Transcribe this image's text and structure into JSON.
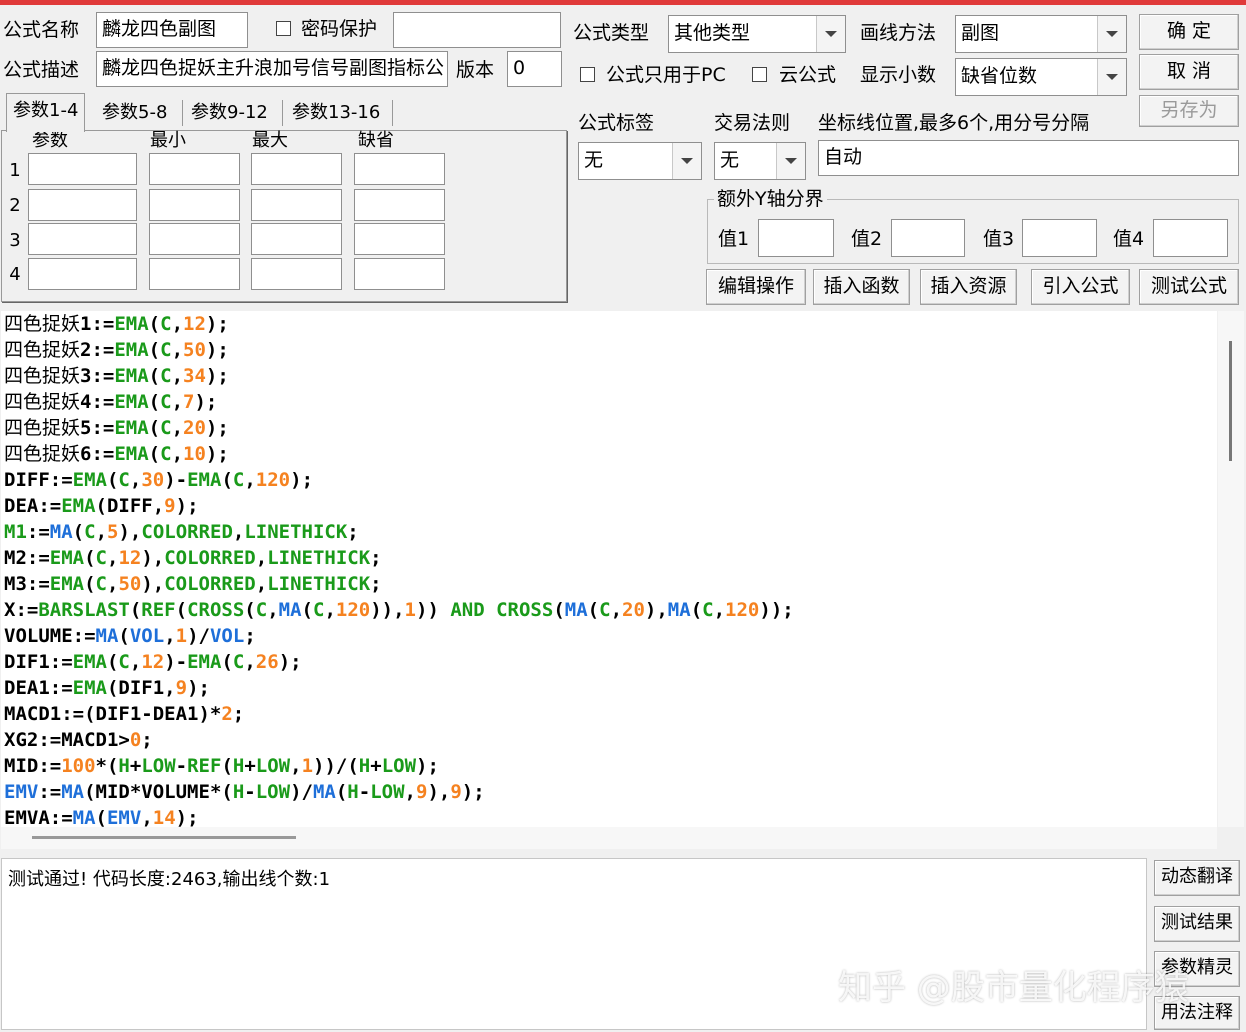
{
  "header": {
    "name_label": "公式名称",
    "name_value": "麟龙四色副图",
    "password_label": "密码保护",
    "password_value": "",
    "desc_label": "公式描述",
    "desc_value": "麟龙四色捉妖主升浪加号信号副图指标公",
    "version_label": "版本",
    "version_value": "0"
  },
  "settings": {
    "type_label": "公式类型",
    "type_value": "其他类型",
    "draw_label": "画线方法",
    "draw_value": "副图",
    "pc_only_label": "公式只用于PC",
    "cloud_label": "云公式",
    "decimal_label": "显示小数",
    "decimal_value": "缺省位数",
    "tag_label": "公式标签",
    "tag_value": "无",
    "rule_label": "交易法则",
    "rule_value": "无",
    "axis_label": "坐标线位置,最多6个,用分号分隔",
    "axis_value": "自动",
    "extra_y_label": "额外Y轴分界",
    "val1": "值1",
    "val2": "值2",
    "val3": "值3",
    "val4": "值4"
  },
  "buttons": {
    "ok": "确  定",
    "cancel": "取  消",
    "save_as": "另存为",
    "edit": "编辑操作",
    "insert_func": "插入函数",
    "insert_res": "插入资源",
    "import": "引入公式",
    "test": "测试公式",
    "dynamic": "动态翻译",
    "result": "测试结果",
    "wizard": "参数精灵",
    "usage": "用法注释"
  },
  "tabs": [
    "参数1-4",
    "参数5-8",
    "参数9-12",
    "参数13-16"
  ],
  "params": {
    "headers": [
      "参数",
      "最小",
      "最大",
      "缺省"
    ],
    "rows": [
      "1",
      "2",
      "3",
      "4"
    ]
  },
  "code_lines": [
    [
      [
        "cn",
        "四色捉妖"
      ],
      [
        "b",
        "1:="
      ],
      [
        "g",
        "EMA"
      ],
      [
        "b",
        "("
      ],
      [
        "g",
        "C"
      ],
      [
        "b",
        ","
      ],
      [
        "o",
        "12"
      ],
      [
        "b",
        ");"
      ]
    ],
    [
      [
        "cn",
        "四色捉妖"
      ],
      [
        "b",
        "2:="
      ],
      [
        "g",
        "EMA"
      ],
      [
        "b",
        "("
      ],
      [
        "g",
        "C"
      ],
      [
        "b",
        ","
      ],
      [
        "o",
        "50"
      ],
      [
        "b",
        ");"
      ]
    ],
    [
      [
        "cn",
        "四色捉妖"
      ],
      [
        "b",
        "3:="
      ],
      [
        "g",
        "EMA"
      ],
      [
        "b",
        "("
      ],
      [
        "g",
        "C"
      ],
      [
        "b",
        ","
      ],
      [
        "o",
        "34"
      ],
      [
        "b",
        ");"
      ]
    ],
    [
      [
        "cn",
        "四色捉妖"
      ],
      [
        "b",
        "4:="
      ],
      [
        "g",
        "EMA"
      ],
      [
        "b",
        "("
      ],
      [
        "g",
        "C"
      ],
      [
        "b",
        ","
      ],
      [
        "o",
        "7"
      ],
      [
        "b",
        ");"
      ]
    ],
    [
      [
        "cn",
        "四色捉妖"
      ],
      [
        "b",
        "5:="
      ],
      [
        "g",
        "EMA"
      ],
      [
        "b",
        "("
      ],
      [
        "g",
        "C"
      ],
      [
        "b",
        ","
      ],
      [
        "o",
        "20"
      ],
      [
        "b",
        ");"
      ]
    ],
    [
      [
        "cn",
        "四色捉妖"
      ],
      [
        "b",
        "6:="
      ],
      [
        "g",
        "EMA"
      ],
      [
        "b",
        "("
      ],
      [
        "g",
        "C"
      ],
      [
        "b",
        ","
      ],
      [
        "o",
        "10"
      ],
      [
        "b",
        ");"
      ]
    ],
    [
      [
        "b",
        "DIFF:="
      ],
      [
        "g",
        "EMA"
      ],
      [
        "b",
        "("
      ],
      [
        "g",
        "C"
      ],
      [
        "b",
        ","
      ],
      [
        "o",
        "30"
      ],
      [
        "b",
        ")-"
      ],
      [
        "g",
        "EMA"
      ],
      [
        "b",
        "("
      ],
      [
        "g",
        "C"
      ],
      [
        "b",
        ","
      ],
      [
        "o",
        "120"
      ],
      [
        "b",
        ");"
      ]
    ],
    [
      [
        "b",
        "DEA:="
      ],
      [
        "g",
        "EMA"
      ],
      [
        "b",
        "(DIFF,"
      ],
      [
        "o",
        "9"
      ],
      [
        "b",
        ");"
      ]
    ],
    [
      [
        "g",
        "M1"
      ],
      [
        "b",
        ":="
      ],
      [
        "bl",
        "MA"
      ],
      [
        "b",
        "("
      ],
      [
        "g",
        "C"
      ],
      [
        "b",
        ","
      ],
      [
        "o",
        "5"
      ],
      [
        "b",
        "),"
      ],
      [
        "g",
        "COLORRED"
      ],
      [
        "b",
        ","
      ],
      [
        "g",
        "LINETHICK"
      ],
      [
        "b",
        ";"
      ]
    ],
    [
      [
        "b",
        "M2:="
      ],
      [
        "g",
        "EMA"
      ],
      [
        "b",
        "("
      ],
      [
        "g",
        "C"
      ],
      [
        "b",
        ","
      ],
      [
        "o",
        "12"
      ],
      [
        "b",
        "),"
      ],
      [
        "g",
        "COLORRED"
      ],
      [
        "b",
        ","
      ],
      [
        "g",
        "LINETHICK"
      ],
      [
        "b",
        ";"
      ]
    ],
    [
      [
        "b",
        "M3:="
      ],
      [
        "g",
        "EMA"
      ],
      [
        "b",
        "("
      ],
      [
        "g",
        "C"
      ],
      [
        "b",
        ","
      ],
      [
        "o",
        "50"
      ],
      [
        "b",
        "),"
      ],
      [
        "g",
        "COLORRED"
      ],
      [
        "b",
        ","
      ],
      [
        "g",
        "LINETHICK"
      ],
      [
        "b",
        ";"
      ]
    ],
    [
      [
        "b",
        "X:="
      ],
      [
        "g",
        "BARSLAST"
      ],
      [
        "b",
        "("
      ],
      [
        "g",
        "REF"
      ],
      [
        "b",
        "("
      ],
      [
        "g",
        "CROSS"
      ],
      [
        "b",
        "("
      ],
      [
        "g",
        "C"
      ],
      [
        "b",
        ","
      ],
      [
        "bl",
        "MA"
      ],
      [
        "b",
        "("
      ],
      [
        "g",
        "C"
      ],
      [
        "b",
        ","
      ],
      [
        "o",
        "120"
      ],
      [
        "b",
        ")),"
      ],
      [
        "o",
        "1"
      ],
      [
        "b",
        ")) "
      ],
      [
        "g",
        "AND"
      ],
      [
        "b",
        " "
      ],
      [
        "g",
        "CROSS"
      ],
      [
        "b",
        "("
      ],
      [
        "bl",
        "MA"
      ],
      [
        "b",
        "("
      ],
      [
        "g",
        "C"
      ],
      [
        "b",
        ","
      ],
      [
        "o",
        "20"
      ],
      [
        "b",
        "),"
      ],
      [
        "bl",
        "MA"
      ],
      [
        "b",
        "("
      ],
      [
        "g",
        "C"
      ],
      [
        "b",
        ","
      ],
      [
        "o",
        "120"
      ],
      [
        "b",
        "));"
      ]
    ],
    [
      [
        "b",
        "VOLUME:="
      ],
      [
        "bl",
        "MA"
      ],
      [
        "b",
        "("
      ],
      [
        "bl",
        "VOL"
      ],
      [
        "b",
        ","
      ],
      [
        "o",
        "1"
      ],
      [
        "b",
        ")/"
      ],
      [
        "bl",
        "VOL"
      ],
      [
        "b",
        ";"
      ]
    ],
    [
      [
        "b",
        "DIF1:="
      ],
      [
        "g",
        "EMA"
      ],
      [
        "b",
        "("
      ],
      [
        "g",
        "C"
      ],
      [
        "b",
        ","
      ],
      [
        "o",
        "12"
      ],
      [
        "b",
        ")-"
      ],
      [
        "g",
        "EMA"
      ],
      [
        "b",
        "("
      ],
      [
        "g",
        "C"
      ],
      [
        "b",
        ","
      ],
      [
        "o",
        "26"
      ],
      [
        "b",
        ");"
      ]
    ],
    [
      [
        "b",
        "DEA1:="
      ],
      [
        "g",
        "EMA"
      ],
      [
        "b",
        "(DIF1,"
      ],
      [
        "o",
        "9"
      ],
      [
        "b",
        ");"
      ]
    ],
    [
      [
        "b",
        "MACD1:=(DIF1-DEA1)*"
      ],
      [
        "o",
        "2"
      ],
      [
        "b",
        ";"
      ]
    ],
    [
      [
        "b",
        "XG2:=MACD1>"
      ],
      [
        "o",
        "0"
      ],
      [
        "b",
        ";"
      ]
    ],
    [
      [
        "b",
        "MID:="
      ],
      [
        "o",
        "100"
      ],
      [
        "b",
        "*("
      ],
      [
        "g",
        "H"
      ],
      [
        "b",
        "+"
      ],
      [
        "g",
        "LOW"
      ],
      [
        "b",
        "-"
      ],
      [
        "g",
        "REF"
      ],
      [
        "b",
        "("
      ],
      [
        "g",
        "H"
      ],
      [
        "b",
        "+"
      ],
      [
        "g",
        "LOW"
      ],
      [
        "b",
        ","
      ],
      [
        "o",
        "1"
      ],
      [
        "b",
        "))/("
      ],
      [
        "g",
        "H"
      ],
      [
        "b",
        "+"
      ],
      [
        "g",
        "LOW"
      ],
      [
        "b",
        ");"
      ]
    ],
    [
      [
        "bl",
        "EMV"
      ],
      [
        "b",
        ":="
      ],
      [
        "bl",
        "MA"
      ],
      [
        "b",
        "(MID*VOLUME*("
      ],
      [
        "g",
        "H"
      ],
      [
        "b",
        "-"
      ],
      [
        "g",
        "LOW"
      ],
      [
        "b",
        ")/"
      ],
      [
        "bl",
        "MA"
      ],
      [
        "b",
        "("
      ],
      [
        "g",
        "H"
      ],
      [
        "b",
        "-"
      ],
      [
        "g",
        "LOW"
      ],
      [
        "b",
        ","
      ],
      [
        "o",
        "9"
      ],
      [
        "b",
        "),"
      ],
      [
        "o",
        "9"
      ],
      [
        "b",
        ");"
      ]
    ],
    [
      [
        "b",
        "EMVA:="
      ],
      [
        "bl",
        "MA"
      ],
      [
        "b",
        "("
      ],
      [
        "bl",
        "EMV"
      ],
      [
        "b",
        ","
      ],
      [
        "o",
        "14"
      ],
      [
        "b",
        ");"
      ]
    ]
  ],
  "output": {
    "message": "测试通过! 代码长度:2463,输出线个数:1"
  },
  "watermark": "知乎 @股市量化程序猿"
}
